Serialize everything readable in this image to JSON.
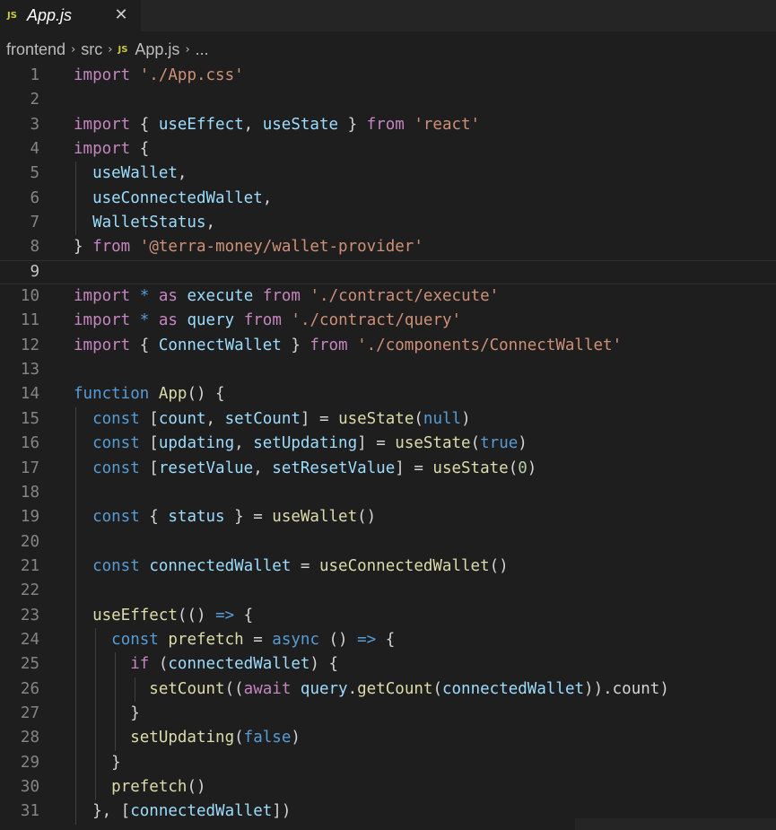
{
  "tab": {
    "lang_badge": "JS",
    "filename": "App.js",
    "close_glyph": "✕"
  },
  "breadcrumb": {
    "items": [
      "frontend",
      "src",
      "App.js",
      "..."
    ],
    "file_badge": "JS",
    "separator": "›"
  },
  "editor": {
    "current_line": 9,
    "lines": [
      {
        "num": "1",
        "indent": 0,
        "tokens": [
          [
            "k",
            "import"
          ],
          [
            "p",
            " "
          ],
          [
            "s",
            "'./App.css'"
          ]
        ]
      },
      {
        "num": "2",
        "indent": 0,
        "tokens": []
      },
      {
        "num": "3",
        "indent": 0,
        "tokens": [
          [
            "k",
            "import"
          ],
          [
            "p",
            " { "
          ],
          [
            "v",
            "useEffect"
          ],
          [
            "p",
            ", "
          ],
          [
            "v",
            "useState"
          ],
          [
            "p",
            " } "
          ],
          [
            "k",
            "from"
          ],
          [
            "p",
            " "
          ],
          [
            "s",
            "'react'"
          ]
        ]
      },
      {
        "num": "4",
        "indent": 0,
        "tokens": [
          [
            "k",
            "import"
          ],
          [
            "p",
            " {"
          ]
        ]
      },
      {
        "num": "5",
        "indent": 1,
        "tokens": [
          [
            "v",
            "useWallet"
          ],
          [
            "p",
            ","
          ]
        ]
      },
      {
        "num": "6",
        "indent": 1,
        "tokens": [
          [
            "v",
            "useConnectedWallet"
          ],
          [
            "p",
            ","
          ]
        ]
      },
      {
        "num": "7",
        "indent": 1,
        "tokens": [
          [
            "v",
            "WalletStatus"
          ],
          [
            "p",
            ","
          ]
        ]
      },
      {
        "num": "8",
        "indent": 0,
        "tokens": [
          [
            "p",
            "} "
          ],
          [
            "k",
            "from"
          ],
          [
            "p",
            " "
          ],
          [
            "s",
            "'@terra-money/wallet-provider'"
          ]
        ]
      },
      {
        "num": "9",
        "indent": 0,
        "tokens": []
      },
      {
        "num": "10",
        "indent": 0,
        "tokens": [
          [
            "k",
            "import"
          ],
          [
            "p",
            " "
          ],
          [
            "b",
            "*"
          ],
          [
            "p",
            " "
          ],
          [
            "k",
            "as"
          ],
          [
            "p",
            " "
          ],
          [
            "v",
            "execute"
          ],
          [
            "p",
            " "
          ],
          [
            "k",
            "from"
          ],
          [
            "p",
            " "
          ],
          [
            "s",
            "'./contract/execute'"
          ]
        ]
      },
      {
        "num": "11",
        "indent": 0,
        "tokens": [
          [
            "k",
            "import"
          ],
          [
            "p",
            " "
          ],
          [
            "b",
            "*"
          ],
          [
            "p",
            " "
          ],
          [
            "k",
            "as"
          ],
          [
            "p",
            " "
          ],
          [
            "v",
            "query"
          ],
          [
            "p",
            " "
          ],
          [
            "k",
            "from"
          ],
          [
            "p",
            " "
          ],
          [
            "s",
            "'./contract/query'"
          ]
        ]
      },
      {
        "num": "12",
        "indent": 0,
        "tokens": [
          [
            "k",
            "import"
          ],
          [
            "p",
            " { "
          ],
          [
            "v",
            "ConnectWallet"
          ],
          [
            "p",
            " } "
          ],
          [
            "k",
            "from"
          ],
          [
            "p",
            " "
          ],
          [
            "s",
            "'./components/ConnectWallet'"
          ]
        ]
      },
      {
        "num": "13",
        "indent": 0,
        "tokens": []
      },
      {
        "num": "14",
        "indent": 0,
        "tokens": [
          [
            "b",
            "function"
          ],
          [
            "p",
            " "
          ],
          [
            "f",
            "App"
          ],
          [
            "p",
            "() {"
          ]
        ]
      },
      {
        "num": "15",
        "indent": 1,
        "tokens": [
          [
            "b",
            "const"
          ],
          [
            "p",
            " ["
          ],
          [
            "v",
            "count"
          ],
          [
            "p",
            ", "
          ],
          [
            "v",
            "setCount"
          ],
          [
            "p",
            "] = "
          ],
          [
            "f",
            "useState"
          ],
          [
            "p",
            "("
          ],
          [
            "b",
            "null"
          ],
          [
            "p",
            ")"
          ]
        ]
      },
      {
        "num": "16",
        "indent": 1,
        "tokens": [
          [
            "b",
            "const"
          ],
          [
            "p",
            " ["
          ],
          [
            "v",
            "updating"
          ],
          [
            "p",
            ", "
          ],
          [
            "v",
            "setUpdating"
          ],
          [
            "p",
            "] = "
          ],
          [
            "f",
            "useState"
          ],
          [
            "p",
            "("
          ],
          [
            "b",
            "true"
          ],
          [
            "p",
            ")"
          ]
        ]
      },
      {
        "num": "17",
        "indent": 1,
        "tokens": [
          [
            "b",
            "const"
          ],
          [
            "p",
            " ["
          ],
          [
            "v",
            "resetValue"
          ],
          [
            "p",
            ", "
          ],
          [
            "v",
            "setResetValue"
          ],
          [
            "p",
            "] = "
          ],
          [
            "f",
            "useState"
          ],
          [
            "p",
            "("
          ],
          [
            "n",
            "0"
          ],
          [
            "p",
            ")"
          ]
        ]
      },
      {
        "num": "18",
        "indent": 1,
        "tokens": []
      },
      {
        "num": "19",
        "indent": 1,
        "tokens": [
          [
            "b",
            "const"
          ],
          [
            "p",
            " { "
          ],
          [
            "v",
            "status"
          ],
          [
            "p",
            " } = "
          ],
          [
            "f",
            "useWallet"
          ],
          [
            "p",
            "()"
          ]
        ]
      },
      {
        "num": "20",
        "indent": 1,
        "tokens": []
      },
      {
        "num": "21",
        "indent": 1,
        "tokens": [
          [
            "b",
            "const"
          ],
          [
            "p",
            " "
          ],
          [
            "v",
            "connectedWallet"
          ],
          [
            "p",
            " = "
          ],
          [
            "f",
            "useConnectedWallet"
          ],
          [
            "p",
            "()"
          ]
        ]
      },
      {
        "num": "22",
        "indent": 1,
        "tokens": []
      },
      {
        "num": "23",
        "indent": 1,
        "tokens": [
          [
            "f",
            "useEffect"
          ],
          [
            "p",
            "(() "
          ],
          [
            "b",
            "=>"
          ],
          [
            "p",
            " {"
          ]
        ]
      },
      {
        "num": "24",
        "indent": 2,
        "tokens": [
          [
            "b",
            "const"
          ],
          [
            "p",
            " "
          ],
          [
            "f",
            "prefetch"
          ],
          [
            "p",
            " = "
          ],
          [
            "b",
            "async"
          ],
          [
            "p",
            " () "
          ],
          [
            "b",
            "=>"
          ],
          [
            "p",
            " {"
          ]
        ]
      },
      {
        "num": "25",
        "indent": 3,
        "tokens": [
          [
            "k",
            "if"
          ],
          [
            "p",
            " ("
          ],
          [
            "v",
            "connectedWallet"
          ],
          [
            "p",
            ") {"
          ]
        ]
      },
      {
        "num": "26",
        "indent": 4,
        "tokens": [
          [
            "f",
            "setCount"
          ],
          [
            "p",
            "(("
          ],
          [
            "k",
            "await"
          ],
          [
            "p",
            " "
          ],
          [
            "v",
            "query"
          ],
          [
            "p",
            "."
          ],
          [
            "f",
            "getCount"
          ],
          [
            "p",
            "("
          ],
          [
            "v",
            "connectedWallet"
          ],
          [
            "p",
            ")).count)"
          ]
        ]
      },
      {
        "num": "27",
        "indent": 3,
        "tokens": [
          [
            "p",
            "}"
          ]
        ]
      },
      {
        "num": "28",
        "indent": 3,
        "tokens": [
          [
            "f",
            "setUpdating"
          ],
          [
            "p",
            "("
          ],
          [
            "b",
            "false"
          ],
          [
            "p",
            ")"
          ]
        ]
      },
      {
        "num": "29",
        "indent": 2,
        "tokens": [
          [
            "p",
            "}"
          ]
        ]
      },
      {
        "num": "30",
        "indent": 2,
        "tokens": [
          [
            "f",
            "prefetch"
          ],
          [
            "p",
            "()"
          ]
        ]
      },
      {
        "num": "31",
        "indent": 1,
        "tokens": [
          [
            "p",
            "}, ["
          ],
          [
            "v",
            "connectedWallet"
          ],
          [
            "p",
            "])"
          ]
        ]
      }
    ]
  }
}
